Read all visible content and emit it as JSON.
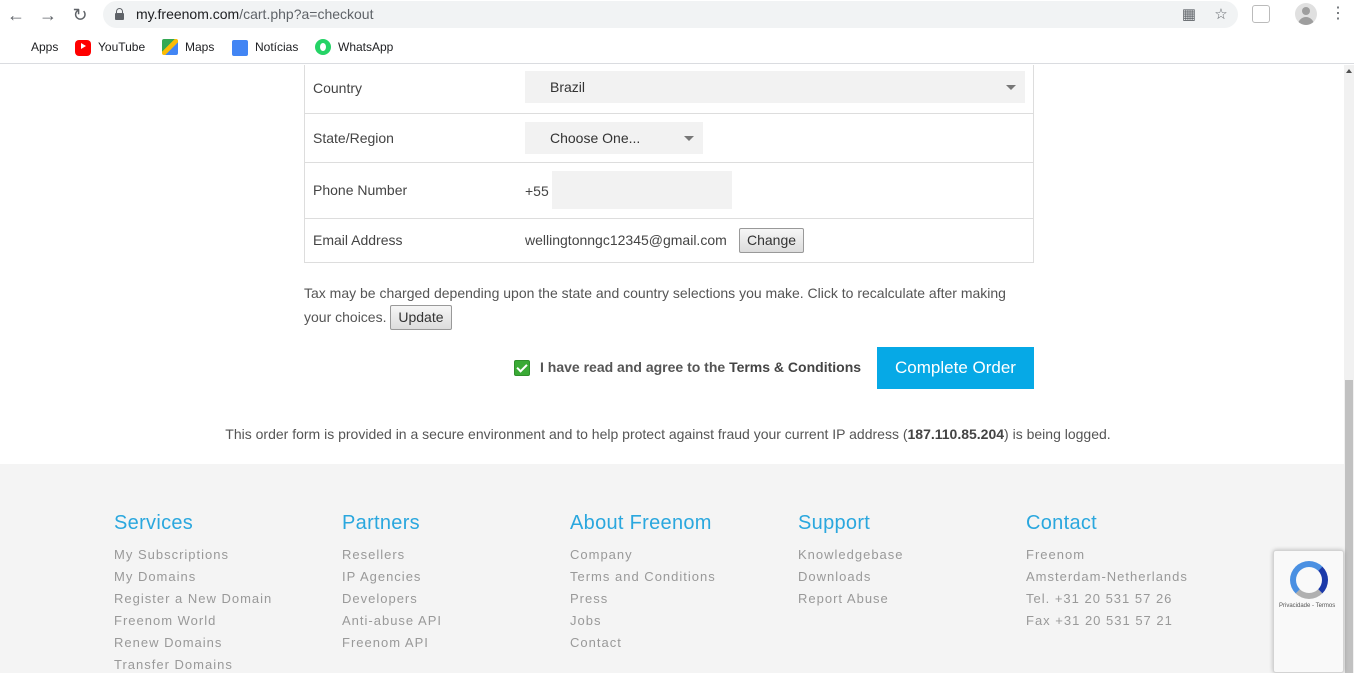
{
  "browser": {
    "url_host": "my.freenom.com",
    "url_path": "/cart.php?a=checkout",
    "bookmarks": [
      {
        "label": "Apps",
        "icon": "apps-grid-icon"
      },
      {
        "label": "YouTube",
        "icon": "youtube-icon"
      },
      {
        "label": "Maps",
        "icon": "maps-icon"
      },
      {
        "label": "Notícias",
        "icon": "news-icon"
      },
      {
        "label": "WhatsApp",
        "icon": "whatsapp-icon"
      }
    ]
  },
  "form": {
    "country": {
      "label": "Country",
      "value": "Brazil"
    },
    "state": {
      "label": "State/Region",
      "value": "Choose One..."
    },
    "phone": {
      "label": "Phone Number",
      "prefix": "+55",
      "value": ""
    },
    "email": {
      "label": "Email Address",
      "value": "wellingtonngc12345@gmail.com",
      "change_label": "Change"
    }
  },
  "tax": {
    "note": "Tax may be charged depending upon the state and country selections you make. Click to recalculate after making your choices.",
    "update_label": "Update"
  },
  "agreement": {
    "prefix": "I have read and agree to the ",
    "terms_link": "Terms & Conditions",
    "checked": true
  },
  "complete_order_label": "Complete Order",
  "secure": {
    "before": "This order form is provided in a secure environment and to help protect against fraud your current IP address (",
    "ip": "187.110.85.204",
    "after": ") is being logged."
  },
  "footer": {
    "columns": [
      {
        "title": "Services",
        "links": [
          "My Subscriptions",
          "My Domains",
          "Register a New Domain",
          "Freenom World",
          "Renew Domains",
          "Transfer Domains"
        ]
      },
      {
        "title": "Partners",
        "links": [
          "Resellers",
          "IP Agencies",
          "Developers",
          "Anti-abuse API",
          "Freenom API"
        ]
      },
      {
        "title": "About Freenom",
        "links": [
          "Company",
          "Terms and Conditions",
          "Press",
          "Jobs",
          "Contact"
        ]
      },
      {
        "title": "Support",
        "links": [
          "Knowledgebase",
          "Downloads",
          "Report Abuse"
        ]
      },
      {
        "title": "Contact",
        "links": [
          "Freenom",
          "Amsterdam-Netherlands",
          "Tel. +31 20 531 57 26",
          "Fax +31 20 531 57 21"
        ]
      }
    ]
  },
  "recaptcha": {
    "text": "Privacidade - Termos"
  },
  "colors": {
    "accent": "#06a9e6",
    "footer_heading": "#2aa7de",
    "check_green": "#3aaa35"
  }
}
